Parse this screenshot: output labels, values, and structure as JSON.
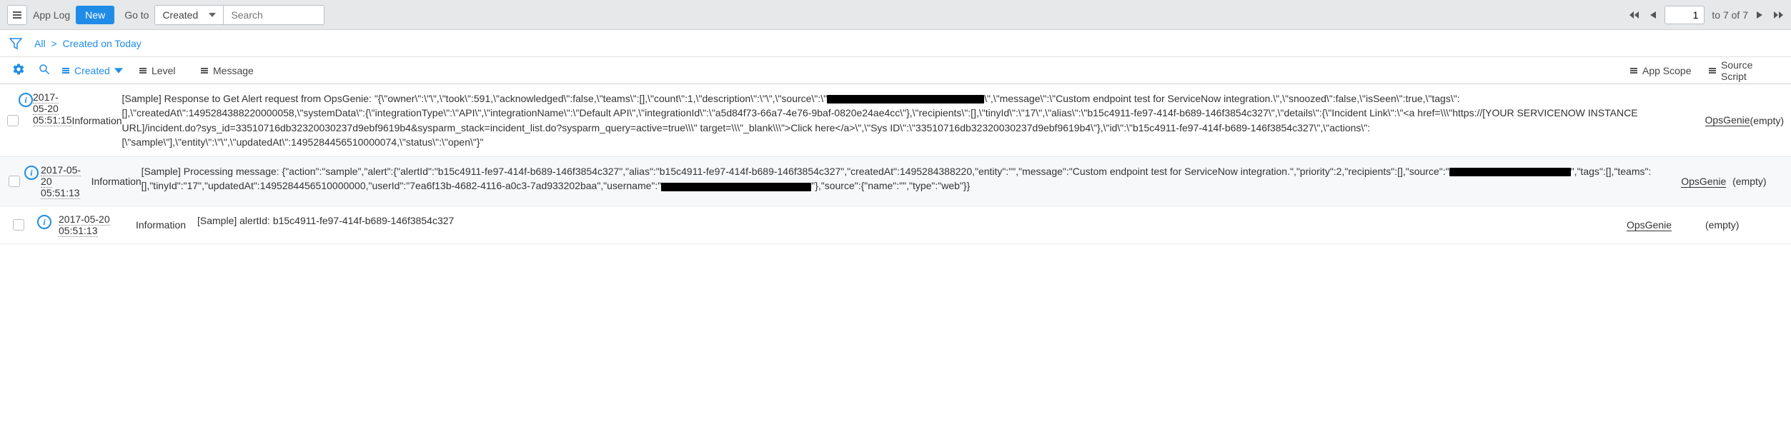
{
  "toolbar": {
    "title": "App Log",
    "new_label": "New",
    "goto_label": "Go to",
    "select_value": "Created",
    "search_placeholder": "Search",
    "pager": {
      "page_value": "1",
      "total_text": "to 7 of 7"
    }
  },
  "filter": {
    "all_label": "All",
    "sep": ">",
    "crumb": "Created on Today"
  },
  "columns": {
    "created": "Created",
    "level": "Level",
    "message": "Message",
    "scope": "App Scope",
    "script": "Source Script"
  },
  "rows": [
    {
      "created_date": "2017-05-20",
      "created_time": "05:51:15",
      "level": "Information",
      "message_pre": "[Sample] Response to Get Alert request from OpsGenie: \"{\\\"owner\\\":\\\"\\\",\\\"took\\\":591,\\\"acknowledged\\\":false,\\\"teams\\\":[],\\\"count\\\":1,\\\"description\\\":\\\"\\\",\\\"source\\\":\\\"",
      "redact1_w": 220,
      "message_post": "\\\",\\\"message\\\":\\\"Custom endpoint test for ServiceNow integration.\\\",\\\"snoozed\\\":false,\\\"isSeen\\\":true,\\\"tags\\\":[],\\\"createdAt\\\":1495284388220000058,\\\"systemData\\\":{\\\"integrationType\\\":\\\"API\\\",\\\"integrationName\\\":\\\"Default API\\\",\\\"integrationId\\\":\\\"a5d84f73-66a7-4e76-9baf-0820e24ae4cc\\\"},\\\"recipients\\\":[],\\\"tinyId\\\":\\\"17\\\",\\\"alias\\\":\\\"b15c4911-fe97-414f-b689-146f3854c327\\\",\\\"details\\\":{\\\"Incident Link\\\":\\\"<a href=\\\\\\\"https://[YOUR SERVICENOW INSTANCE URL]/incident.do?sys_id=33510716db32320030237d9ebf9619b4&sysparm_stack=incident_list.do?sysparm_query=active=true\\\\\\\" target=\\\\\\\"_blank\\\\\\\">Click here</a>\\\",\\\"Sys ID\\\":\\\"33510716db32320030237d9ebf9619b4\\\"},\\\"id\\\":\\\"b15c4911-fe97-414f-b689-146f3854c327\\\",\\\"actions\\\":[\\\"sample\\\"],\\\"entity\\\":\\\"\\\",\\\"updatedAt\\\":1495284456510000074,\\\"status\\\":\\\"open\\\"}\"",
      "scope": "OpsGenie",
      "script": "(empty)"
    },
    {
      "created_date": "2017-05-20",
      "created_time": "05:51:13",
      "level": "Information",
      "message_pre": "[Sample] Processing message: {\"action\":\"sample\",\"alert\":{\"alertId\":\"b15c4911-fe97-414f-b689-146f3854c327\",\"alias\":\"b15c4911-fe97-414f-b689-146f3854c327\",\"createdAt\":1495284388220,\"entity\":\"\",\"message\":\"Custom endpoint test for ServiceNow integration.\",\"priority\":2,\"recipients\":[],\"source\":\"",
      "redact1_w": 170,
      "message_mid": "\",\"tags\":[],\"teams\":[],\"tinyId\":\"17\",\"updatedAt\":1495284456510000000,\"userId\":\"7ea6f13b-4682-4116-a0c3-7ad933202baa\",\"username\":\"",
      "redact2_w": 210,
      "message_post": "\"},\"source\":{\"name\":\"\",\"type\":\"web\"}}",
      "scope": "OpsGenie",
      "script": "(empty)"
    },
    {
      "created_date": "2017-05-20",
      "created_time": "05:51:13",
      "level": "Information",
      "message_pre": "[Sample] alertId: b15c4911-fe97-414f-b689-146f3854c327",
      "scope": "OpsGenie",
      "script": "(empty)"
    }
  ]
}
